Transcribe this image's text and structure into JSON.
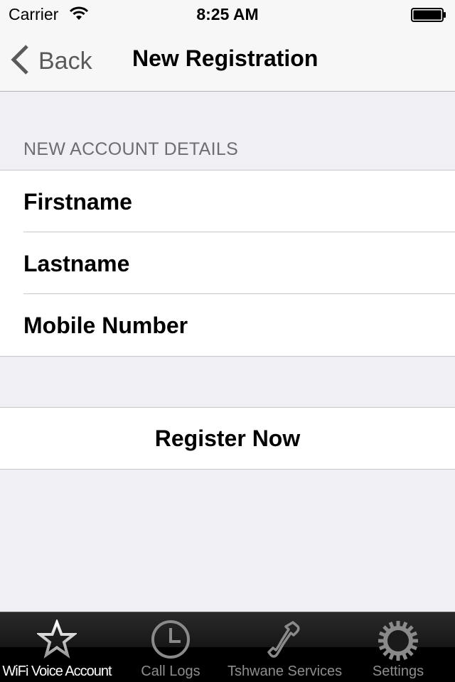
{
  "status_bar": {
    "carrier": "Carrier",
    "time": "8:25 AM",
    "wifi_icon": "wifi-icon",
    "battery_icon": "battery-icon"
  },
  "nav_bar": {
    "back_label": "Back",
    "title": "New Registration"
  },
  "form": {
    "section_header": "NEW ACCOUNT DETAILS",
    "fields": [
      {
        "label": "Firstname",
        "value": "",
        "placeholder": ""
      },
      {
        "label": "Lastname",
        "value": "",
        "placeholder": ""
      },
      {
        "label": "Mobile Number",
        "value": "",
        "placeholder": ""
      }
    ],
    "submit_label": "Register Now"
  },
  "tab_bar": {
    "active_index": 0,
    "tabs": [
      {
        "label": "WiFi Voice Account",
        "icon": "star-icon"
      },
      {
        "label": "Call Logs",
        "icon": "clock-icon"
      },
      {
        "label": "Tshwane Services",
        "icon": "phone-icon"
      },
      {
        "label": "Settings",
        "icon": "gear-icon"
      }
    ]
  }
}
